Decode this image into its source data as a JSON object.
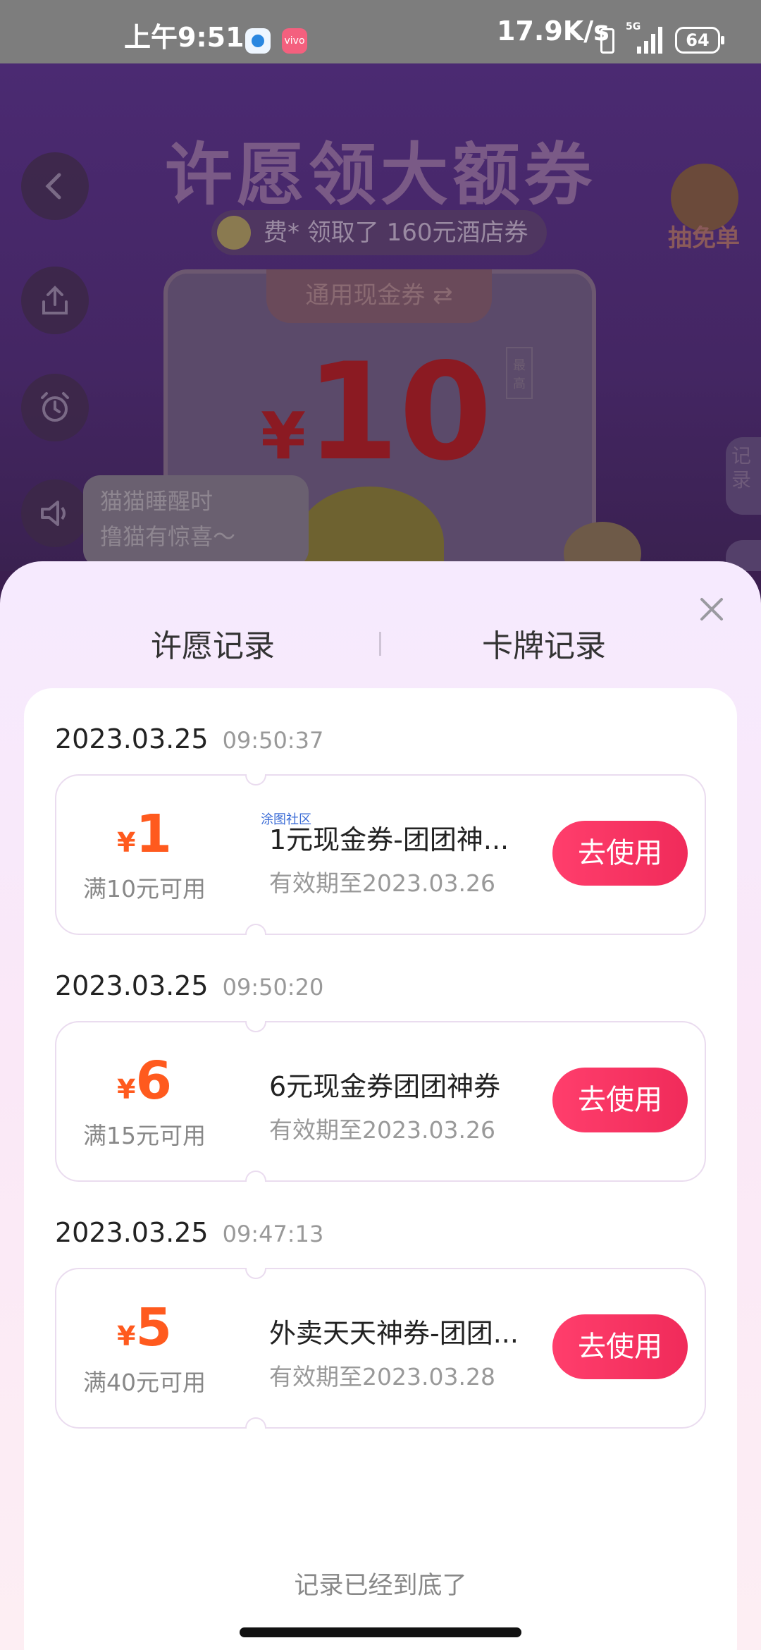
{
  "status_bar": {
    "time": "上午9:51",
    "app2_icon": "vivo",
    "net_speed": "17.9K/s",
    "network": "5G",
    "battery": "64"
  },
  "background": {
    "title": "许愿领大额券",
    "ticker": "费* 领取了 160元酒店券",
    "free_label": "抽免单",
    "coupon_tab": "通用现金券 ⇄",
    "coupon_yen": "¥",
    "coupon_value": "10",
    "coupon_side": "最高",
    "bubble_line1": "猫猫睡醒时",
    "bubble_line2": "撸猫有惊喜～",
    "right_tab": "记录"
  },
  "sheet": {
    "tabs": [
      "许愿记录",
      "卡牌记录"
    ],
    "watermark": "涂图社区",
    "use_label": "去使用",
    "end_note": "记录已经到底了",
    "records": [
      {
        "date": "2023.03.25",
        "time": "09:50:37",
        "yen": "¥",
        "amount": "1",
        "threshold": "满10元可用",
        "name": "1元现金券-团团神...",
        "expiry": "有效期至2023.03.26"
      },
      {
        "date": "2023.03.25",
        "time": "09:50:20",
        "yen": "¥",
        "amount": "6",
        "threshold": "满15元可用",
        "name": "6元现金券团团神券",
        "expiry": "有效期至2023.03.26"
      },
      {
        "date": "2023.03.25",
        "time": "09:47:13",
        "yen": "¥",
        "amount": "5",
        "threshold": "满40元可用",
        "name": "外卖天天神券-团团...",
        "expiry": "有效期至2023.03.28"
      }
    ]
  },
  "colors": {
    "accent_orange": "#ff5a1e",
    "button_red": "#f02b5a",
    "sheet_bg": "#f6eafe"
  }
}
